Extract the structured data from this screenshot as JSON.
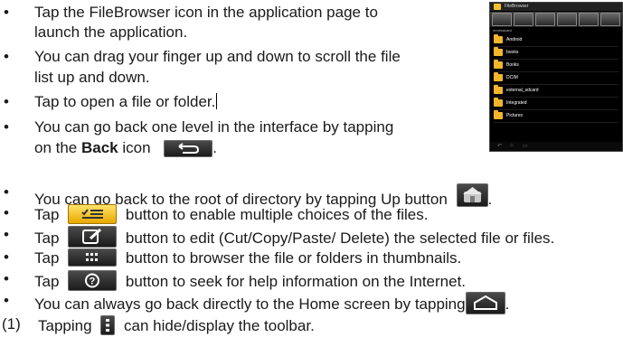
{
  "bullet_char": "•",
  "lines": {
    "b1a": "Tap the FileBrowser icon in the application page to",
    "b1b": "launch the application.",
    "b2a": "You can drag your finger up and down to scroll the file",
    "b2b": "list up and down.",
    "b3": "Tap to open a file or folder.",
    "b4a": "You can go back one level in the interface by tapping",
    "b4b_pre": "on the ",
    "b4b_bold": "Back",
    "b4b_post": " icon",
    "b4b_end": ".",
    "b5_pre": "You can go back to the root of directory by tapping Up button",
    "b5_end": ".",
    "b6_pre": "Tap",
    "b6_post": "button to enable multiple choices of the files.",
    "b7_pre": "Tap",
    "b7_post": "button to edit (Cut/Copy/Paste/ Delete) the selected file or files.",
    "b8_pre": "Tap",
    "b8_post": "button to browser the file or folders in thumbnails.",
    "b9_pre": "Tap",
    "b9_post": "button to seek for help information on the Internet.",
    "b10_pre": "You can always go back directly to the Home screen by tapping",
    "b10_end": ".",
    "n1_num": "(1)",
    "n1_pre": "Tapping",
    "n1_post": "can hide/display the toolbar."
  },
  "icons": {
    "back": "back-arrow-icon",
    "home_folder": "home-folder-icon",
    "multi_select": "multi-select-icon",
    "edit": "edit-icon",
    "thumbnails": "thumbnails-icon",
    "help": "help-icon",
    "android_home": "android-home-icon",
    "menu": "menu-dots-icon"
  },
  "colors": {
    "accent_yellow": "#f3c12b",
    "icon_dark": "#2a2a2a",
    "text": "#1a1a1a"
  },
  "phone": {
    "app_title": "FileBrowser",
    "path": "/mnt/sdcard",
    "folders": [
      "Android",
      "books",
      "Books",
      "DCIM",
      "external_sdcard",
      "Integrated",
      "Pictures"
    ]
  }
}
